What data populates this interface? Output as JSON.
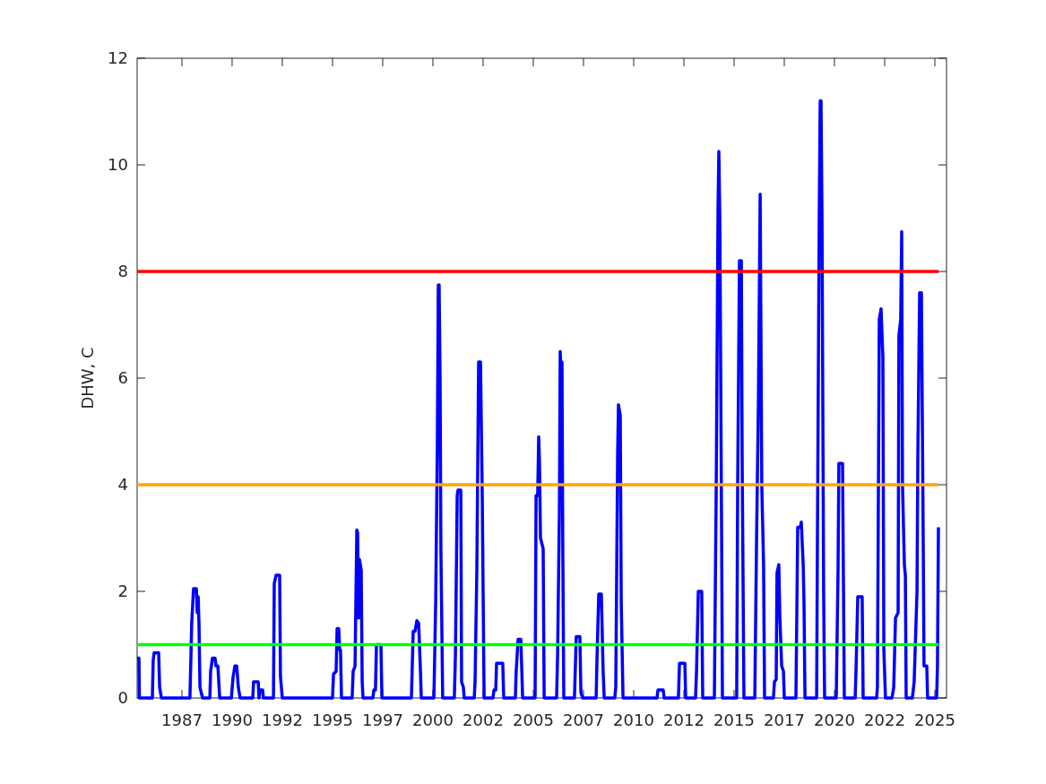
{
  "figure": {
    "chart_data": {
      "type": "line",
      "ylabel": "DHW, C",
      "xlim": [
        1985.27,
        2025.58
      ],
      "ylim": [
        0,
        12
      ],
      "xticks": [
        {
          "value": 1987.5,
          "label": "1987"
        },
        {
          "value": 1990,
          "label": "1990"
        },
        {
          "value": 1992.5,
          "label": "1992"
        },
        {
          "value": 1995,
          "label": "1995"
        },
        {
          "value": 1997.5,
          "label": "1997"
        },
        {
          "value": 2000,
          "label": "2000"
        },
        {
          "value": 2002.5,
          "label": "2002"
        },
        {
          "value": 2005,
          "label": "2005"
        },
        {
          "value": 2007.5,
          "label": "2007"
        },
        {
          "value": 2010,
          "label": "2010"
        },
        {
          "value": 2012.5,
          "label": "2012"
        },
        {
          "value": 2015,
          "label": "2015"
        },
        {
          "value": 2017.5,
          "label": "2017"
        },
        {
          "value": 2020,
          "label": "2020"
        },
        {
          "value": 2022.5,
          "label": "2022"
        },
        {
          "value": 2025,
          "label": "2025"
        }
      ],
      "yticks": [
        0,
        2,
        4,
        6,
        8,
        10,
        12
      ],
      "x": [
        1985.27,
        1985.36,
        1985.38,
        1986.03,
        1986.07,
        1986.12,
        1986.34,
        1986.39,
        1986.48,
        1987.9,
        1987.99,
        1988.08,
        1988.22,
        1988.26,
        1988.31,
        1988.35,
        1988.4,
        1988.53,
        1988.89,
        1988.93,
        1989.02,
        1989.15,
        1989.2,
        1989.29,
        1989.38,
        1989.96,
        1990.05,
        1990.14,
        1990.23,
        1990.31,
        1990.4,
        1991.03,
        1991.07,
        1991.3,
        1991.34,
        1991.39,
        1991.52,
        1991.56,
        1992.06,
        1992.1,
        1992.19,
        1992.37,
        1992.41,
        1992.5,
        1995.0,
        1995.05,
        1995.18,
        1995.23,
        1995.31,
        1995.36,
        1995.4,
        1995.45,
        1995.98,
        1996.03,
        1996.12,
        1996.21,
        1996.25,
        1996.3,
        1996.34,
        1996.43,
        1996.48,
        1996.52,
        1997.01,
        1997.06,
        1997.14,
        1997.19,
        1997.41,
        1997.46,
        1998.93,
        1999.02,
        1999.11,
        1999.2,
        1999.29,
        1999.38,
        1999.42,
        2000.05,
        2000.14,
        2000.22,
        2000.27,
        2000.31,
        2000.36,
        2000.4,
        2000.49,
        2001.07,
        2001.12,
        2001.21,
        2001.25,
        2001.39,
        2001.43,
        2001.52,
        2001.56,
        2002.06,
        2002.1,
        2002.19,
        2002.28,
        2002.37,
        2002.46,
        2002.5,
        2002.55,
        2002.99,
        2003.04,
        2003.13,
        2003.17,
        2003.48,
        2003.53,
        2004.11,
        2004.15,
        2004.24,
        2004.38,
        2004.42,
        2004.47,
        2005.09,
        2005.14,
        2005.22,
        2005.27,
        2005.31,
        2005.36,
        2005.49,
        2005.54,
        2006.16,
        2006.21,
        2006.3,
        2006.34,
        2006.39,
        2006.43,
        2006.47,
        2006.52,
        2007.05,
        2007.14,
        2007.32,
        2007.37,
        2007.46,
        2008.13,
        2008.17,
        2008.26,
        2008.39,
        2008.48,
        2008.53,
        2009.06,
        2009.11,
        2009.2,
        2009.24,
        2009.33,
        2009.38,
        2009.47,
        2011.16,
        2011.21,
        2011.47,
        2011.52,
        2012.23,
        2012.28,
        2012.55,
        2012.59,
        2013.08,
        2013.13,
        2013.22,
        2013.39,
        2013.44,
        2014.02,
        2014.11,
        2014.2,
        2014.24,
        2014.29,
        2014.38,
        2014.42,
        2015.13,
        2015.18,
        2015.27,
        2015.36,
        2015.4,
        2015.49,
        2016.03,
        2016.12,
        2016.21,
        2016.3,
        2016.38,
        2016.47,
        2016.52,
        2016.96,
        2017.01,
        2017.1,
        2017.14,
        2017.23,
        2017.28,
        2017.37,
        2017.46,
        2017.5,
        2018.08,
        2018.17,
        2018.3,
        2018.35,
        2018.44,
        2018.48,
        2018.53,
        2019.11,
        2019.15,
        2019.24,
        2019.29,
        2019.33,
        2019.38,
        2019.46,
        2019.51,
        2020.09,
        2020.18,
        2020.22,
        2020.4,
        2020.45,
        2020.49,
        2021.03,
        2021.07,
        2021.16,
        2021.38,
        2021.43,
        2022.1,
        2022.14,
        2022.23,
        2022.32,
        2022.41,
        2022.46,
        2022.54,
        2022.86,
        2022.95,
        2023.04,
        2023.17,
        2023.21,
        2023.3,
        2023.35,
        2023.39,
        2023.48,
        2023.53,
        2023.57,
        2023.88,
        2023.97,
        2024.11,
        2024.15,
        2024.24,
        2024.33,
        2024.42,
        2024.46,
        2024.6,
        2024.64,
        2025.09,
        2025.13,
        2025.18
      ],
      "series": [
        {
          "color": "#0000ff",
          "values": [
            0.75,
            0.75,
            0,
            0,
            0.7,
            0.85,
            0.85,
            0.2,
            0,
            0,
            1.4,
            2.05,
            2.05,
            1.6,
            1.9,
            1.4,
            0.2,
            0,
            0,
            0.5,
            0.75,
            0.75,
            0.6,
            0.6,
            0,
            0,
            0.4,
            0.6,
            0.6,
            0.2,
            0,
            0,
            0.3,
            0.3,
            0,
            0.15,
            0.15,
            0,
            0,
            2.15,
            2.3,
            2.3,
            0.4,
            0,
            0,
            0.45,
            0.5,
            1.3,
            1.3,
            0.9,
            0.9,
            0,
            0,
            0.5,
            0.6,
            3.15,
            3.1,
            1.5,
            2.6,
            2.4,
            0.3,
            0,
            0,
            0.15,
            0.15,
            1.0,
            1.0,
            0,
            0,
            1.25,
            1.25,
            1.45,
            1.4,
            0.5,
            0,
            0,
            1.8,
            4.7,
            7.75,
            7.75,
            6.0,
            2.8,
            0,
            0,
            0.8,
            3.8,
            3.9,
            3.9,
            0.3,
            0.2,
            0,
            0,
            0.3,
            2.4,
            6.3,
            6.3,
            3.7,
            2.0,
            0,
            0,
            0.15,
            0.15,
            0.65,
            0.65,
            0,
            0,
            0.5,
            1.1,
            1.1,
            0.6,
            0,
            0,
            3.8,
            3.8,
            4.9,
            4.4,
            3.0,
            2.8,
            0,
            0,
            0.8,
            3.5,
            6.5,
            6.0,
            6.3,
            2.8,
            0,
            0,
            1.15,
            1.15,
            0.1,
            0,
            0,
            0.7,
            1.95,
            1.95,
            0.5,
            0,
            0,
            0.2,
            4.6,
            5.5,
            5.3,
            1.8,
            0,
            0,
            0.15,
            0.15,
            0,
            0,
            0.65,
            0.65,
            0,
            0,
            0.5,
            2.0,
            2.0,
            0,
            0,
            4.0,
            9.2,
            10.25,
            9.0,
            3.0,
            0,
            0,
            4.0,
            8.2,
            8.2,
            4.5,
            0,
            0,
            3.0,
            5.5,
            9.45,
            4.0,
            2.5,
            0,
            0,
            0.3,
            0.35,
            2.35,
            2.5,
            1.5,
            0.6,
            0.5,
            0,
            0,
            3.2,
            3.2,
            3.3,
            2.5,
            1.8,
            0,
            0,
            3.0,
            9.0,
            11.2,
            11.2,
            9.0,
            2.0,
            0,
            0,
            2.4,
            4.4,
            4.4,
            2.0,
            0,
            0,
            0.5,
            1.9,
            1.9,
            0,
            0,
            0.2,
            7.1,
            7.3,
            6.4,
            0.9,
            0,
            0,
            0.2,
            1.5,
            1.6,
            6.8,
            7.1,
            8.75,
            4.0,
            2.5,
            2.3,
            0,
            0,
            0.3,
            2.0,
            4.5,
            7.6,
            7.6,
            3.0,
            0.6,
            0.6,
            0,
            0,
            0.6,
            3.2
          ]
        }
      ],
      "ref_lines": [
        {
          "axis": "y",
          "value": 8,
          "color": "#ff0000"
        },
        {
          "axis": "y",
          "value": 4,
          "color": "#ffa500"
        },
        {
          "axis": "y",
          "value": 1,
          "color": "#00ff00"
        }
      ]
    }
  }
}
